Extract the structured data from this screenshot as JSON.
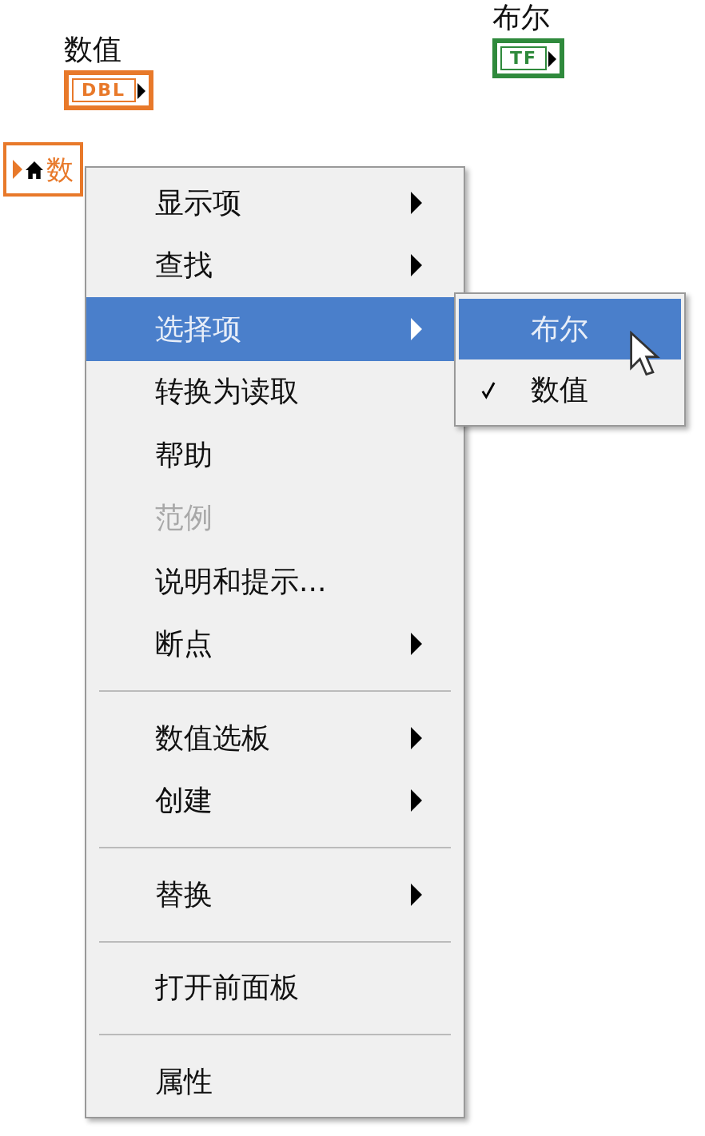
{
  "terminals": [
    {
      "label": "数值",
      "badge": "DBL",
      "kind": "numeric"
    },
    {
      "label": "布尔",
      "badge": "TF",
      "kind": "boolean"
    }
  ],
  "local_variable": {
    "label": "数"
  },
  "context_menu": {
    "items": [
      {
        "kind": "item",
        "label": "显示项",
        "submenu": true,
        "selected": false,
        "disabled": false
      },
      {
        "kind": "item",
        "label": "查找",
        "submenu": true,
        "selected": false,
        "disabled": false
      },
      {
        "kind": "item",
        "label": "选择项",
        "submenu": true,
        "selected": true,
        "disabled": false
      },
      {
        "kind": "item",
        "label": "转换为读取",
        "submenu": false,
        "selected": false,
        "disabled": false
      },
      {
        "kind": "item",
        "label": "帮助",
        "submenu": false,
        "selected": false,
        "disabled": false
      },
      {
        "kind": "item",
        "label": "范例",
        "submenu": false,
        "selected": false,
        "disabled": true
      },
      {
        "kind": "item",
        "label": "说明和提示...",
        "submenu": false,
        "selected": false,
        "disabled": false
      },
      {
        "kind": "item",
        "label": "断点",
        "submenu": true,
        "selected": false,
        "disabled": false
      },
      {
        "kind": "separator"
      },
      {
        "kind": "item",
        "label": "数值选板",
        "submenu": true,
        "selected": false,
        "disabled": false
      },
      {
        "kind": "item",
        "label": "创建",
        "submenu": true,
        "selected": false,
        "disabled": false
      },
      {
        "kind": "separator"
      },
      {
        "kind": "item",
        "label": "替换",
        "submenu": true,
        "selected": false,
        "disabled": false
      },
      {
        "kind": "separator"
      },
      {
        "kind": "item",
        "label": "打开前面板",
        "submenu": false,
        "selected": false,
        "disabled": false
      },
      {
        "kind": "separator"
      },
      {
        "kind": "item",
        "label": "属性",
        "submenu": false,
        "selected": false,
        "disabled": false
      }
    ]
  },
  "submenu": {
    "items": [
      {
        "label": "布尔",
        "selected": true,
        "checked": false
      },
      {
        "label": "数值",
        "selected": false,
        "checked": true
      }
    ]
  }
}
